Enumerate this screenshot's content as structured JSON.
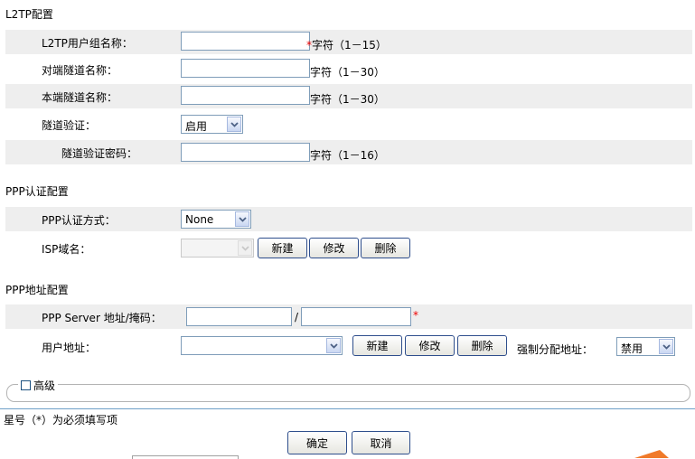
{
  "sections": {
    "l2tp": "L2TP配置",
    "ppp_auth": "PPP认证配置",
    "ppp_addr": "PPP地址配置"
  },
  "l2tp": {
    "group_name_label": "L2TP用户组名称：",
    "group_name_hint": "字符（1－15）",
    "peer_tunnel_label": "对端隧道名称：",
    "peer_tunnel_hint": "字符（1－30）",
    "local_tunnel_label": "本端隧道名称：",
    "local_tunnel_hint": "字符（1－30）",
    "tunnel_auth_label": "隧道验证：",
    "tunnel_auth_value": "启用",
    "tunnel_password_label": "隧道验证密码：",
    "tunnel_password_hint": "字符（1－16）"
  },
  "ppp_auth": {
    "method_label": "PPP认证方式：",
    "method_value": "None",
    "isp_label": "ISP域名：",
    "new_button": "新建",
    "modify_button": "修改",
    "delete_button": "删除"
  },
  "ppp_addr": {
    "server_label": "PPP Server 地址/掩码：",
    "slash": "/",
    "user_addr_label": "用户地址：",
    "new_button": "新建",
    "modify_button": "修改",
    "delete_button": "删除",
    "force_label": "强制分配地址：",
    "force_value": "禁用"
  },
  "advanced_label": "高级",
  "required_note": "星号（*）为必须填写项",
  "ok_button": "确定",
  "cancel_button": "取消",
  "star": "*"
}
